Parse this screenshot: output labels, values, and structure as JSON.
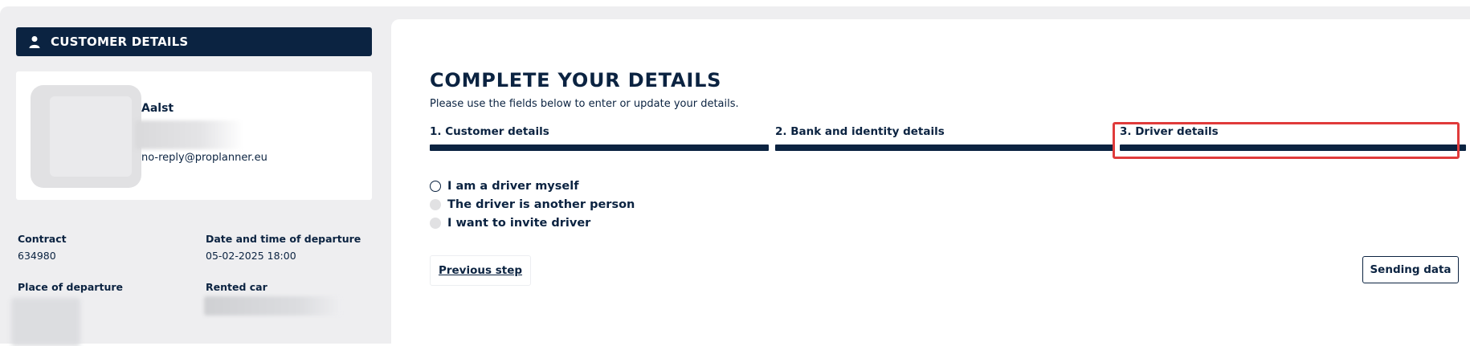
{
  "sidebar": {
    "header_title": "CUSTOMER DETAILS",
    "header_icon": "user-icon",
    "profile": {
      "name": "Aalst",
      "email": "no-reply@proplanner.eu"
    },
    "info": {
      "contract_label": "Contract",
      "contract_value": "634980",
      "departure_datetime_label": "Date and time of departure",
      "departure_datetime_value": "05-02-2025 18:00",
      "place_label": "Place of departure",
      "rented_car_label": "Rented car"
    }
  },
  "main": {
    "title": "COMPLETE YOUR DETAILS",
    "subtitle": "Please use the fields below to enter or update your details.",
    "steps": [
      {
        "label": "1. Customer details"
      },
      {
        "label": "2. Bank and identity details"
      },
      {
        "label": "3. Driver details"
      }
    ],
    "driver_options": [
      {
        "label": "I am a driver myself"
      },
      {
        "label": "The driver is another person"
      },
      {
        "label": "I want to invite driver"
      }
    ],
    "previous_label": "Previous step",
    "send_label": "Sending data"
  },
  "colors": {
    "primary": "#0b2341",
    "highlight": "#e03b3b",
    "panel_bg": "#eeeef0"
  }
}
